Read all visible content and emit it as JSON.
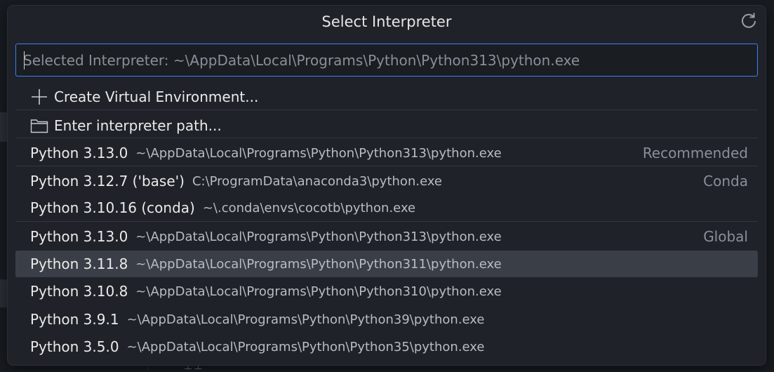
{
  "dialog": {
    "title": "Select Interpreter",
    "search_placeholder": "Selected Interpreter: ~\\AppData\\Local\\Programs\\Python\\Python313\\python.exe"
  },
  "actions": [
    {
      "label": "Create Virtual Environment...",
      "icon": "plus-icon"
    },
    {
      "label": "Enter interpreter path...",
      "icon": "folder-icon"
    }
  ],
  "interpreters": [
    {
      "label": "Python 3.13.0",
      "path": "~\\AppData\\Local\\Programs\\Python\\Python313\\python.exe",
      "tag": "Recommended"
    },
    {
      "label": "Python 3.12.7 ('base')",
      "path": "C:\\ProgramData\\anaconda3\\python.exe",
      "tag": "Conda"
    },
    {
      "label": "Python 3.10.16 (conda)",
      "path": "~\\.conda\\envs\\cocotb\\python.exe",
      "tag": ""
    },
    {
      "label": "Python 3.13.0",
      "path": "~\\AppData\\Local\\Programs\\Python\\Python313\\python.exe",
      "tag": "Global"
    },
    {
      "label": "Python 3.11.8",
      "path": "~\\AppData\\Local\\Programs\\Python\\Python311\\python.exe",
      "tag": "",
      "selected": true
    },
    {
      "label": "Python 3.10.8",
      "path": "~\\AppData\\Local\\Programs\\Python\\Python310\\python.exe",
      "tag": ""
    },
    {
      "label": "Python 3.9.1",
      "path": "~\\AppData\\Local\\Programs\\Python\\Python39\\python.exe",
      "tag": ""
    },
    {
      "label": "Python 3.5.0",
      "path": "~\\AppData\\Local\\Programs\\Python\\Python35\\python.exe",
      "tag": ""
    }
  ],
  "colors": {
    "focus_border": "#3b82f6",
    "selected_row": "#3a3f47",
    "panel": "#1f2228"
  }
}
